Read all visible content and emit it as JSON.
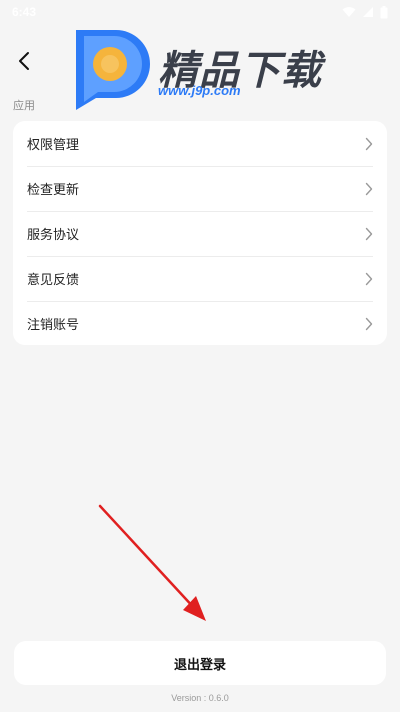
{
  "status_bar": {
    "time": "6:43",
    "icons": [
      "wifi-icon",
      "signal-icon",
      "battery-icon"
    ]
  },
  "header": {
    "back_icon": "chevron-left-icon"
  },
  "watermark": {
    "brand": "精品下载",
    "url": "www.j9p.com",
    "colors": {
      "blue": "#2d7bf6",
      "orange": "#f5b43c"
    }
  },
  "section": {
    "label": "应用"
  },
  "menu": {
    "items": [
      {
        "label": "权限管理"
      },
      {
        "label": "检查更新"
      },
      {
        "label": "服务协议"
      },
      {
        "label": "意见反馈"
      },
      {
        "label": "注销账号"
      }
    ],
    "chevron_icon": "chevron-right-icon"
  },
  "footer": {
    "logout_label": "退出登录",
    "version": "Version : 0.6.0"
  },
  "colors": {
    "background": "#f5f5f5",
    "card": "#ffffff",
    "annotation_arrow": "#e02020"
  }
}
